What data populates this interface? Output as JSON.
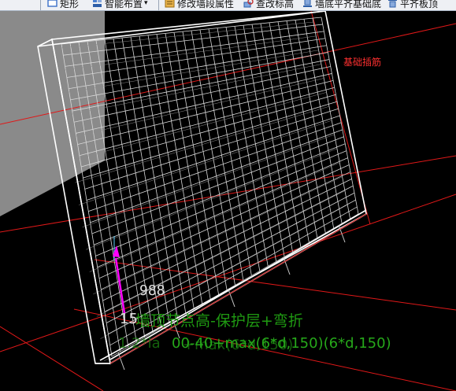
{
  "toolbar": {
    "items": [
      {
        "label": "矩形",
        "icon": "rectangle-icon"
      },
      {
        "label": "智能布置",
        "icon": "smart-layout-icon",
        "dropdown": "▾"
      },
      {
        "label": "修改墙段属性",
        "icon": "edit-wall-props-icon"
      },
      {
        "label": "查改标高",
        "icon": "check-elevation-icon"
      },
      {
        "label": "墙底平齐基础底",
        "icon": "wall-bottom-align-icon"
      },
      {
        "label": "平齐板顶",
        "icon": "align-slab-top-icon"
      }
    ]
  },
  "viewport": {
    "labels": {
      "foundation_dowel": "基础插筋",
      "dimension_value": "988",
      "dimension_prefix": "15",
      "formula_line1": "墙顶节点高-保护层+弯折",
      "formula_ghost_a": "1.2*la",
      "formula_line2": "5",
      "formula_line2_tail": "-40",
      "formula_ghost_b": "+max(6*d,150)",
      "formula_main": "00-40+max(6*d,150)(6*d,150)"
    },
    "colors": {
      "background": "#000000",
      "wireframe": "#ffffff",
      "grid_line": "#ff2020",
      "annotation_red": "#ff3030",
      "formula_green": "#1f9a12",
      "arrow_magenta": "#ff00ff",
      "dimension_text": "#e0e0e0",
      "wall_face": "#8a8a8a"
    }
  }
}
